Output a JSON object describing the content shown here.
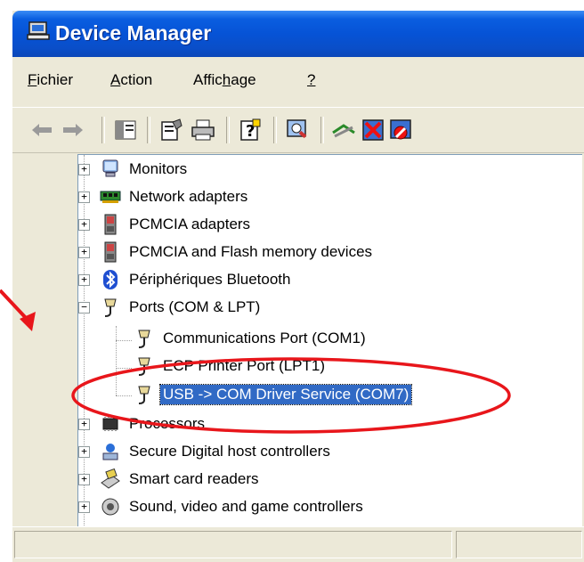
{
  "window": {
    "title": "Device Manager"
  },
  "menu": [
    {
      "underline": "F",
      "rest": "ichier"
    },
    {
      "underline": "A",
      "rest": "ction"
    },
    {
      "underline": "",
      "pre": "Affic",
      "und2": "h",
      "rest": "age"
    },
    {
      "underline": "?",
      "rest": ""
    }
  ],
  "tree": {
    "monitors": "Monitors",
    "network": "Network adapters",
    "pcmcia": "PCMCIA adapters",
    "pcmcia_flash": "PCMCIA and Flash memory devices",
    "bluetooth": "Périphériques Bluetooth",
    "ports": "Ports (COM & LPT)",
    "com1": "Communications Port (COM1)",
    "lpt1": "ECP Printer Port (LPT1)",
    "com7": "USB -> COM Driver Service (COM7)",
    "processors": "Processors",
    "sd": "Secure Digital host controllers",
    "smartcard": "Smart card readers",
    "sound": "Sound, video and game controllers"
  },
  "expanders": {
    "plus": "+",
    "minus": "−"
  },
  "colors": {
    "annotation": "#e8161b",
    "selection": "#316ac5",
    "titlebar": "#0653d6"
  }
}
